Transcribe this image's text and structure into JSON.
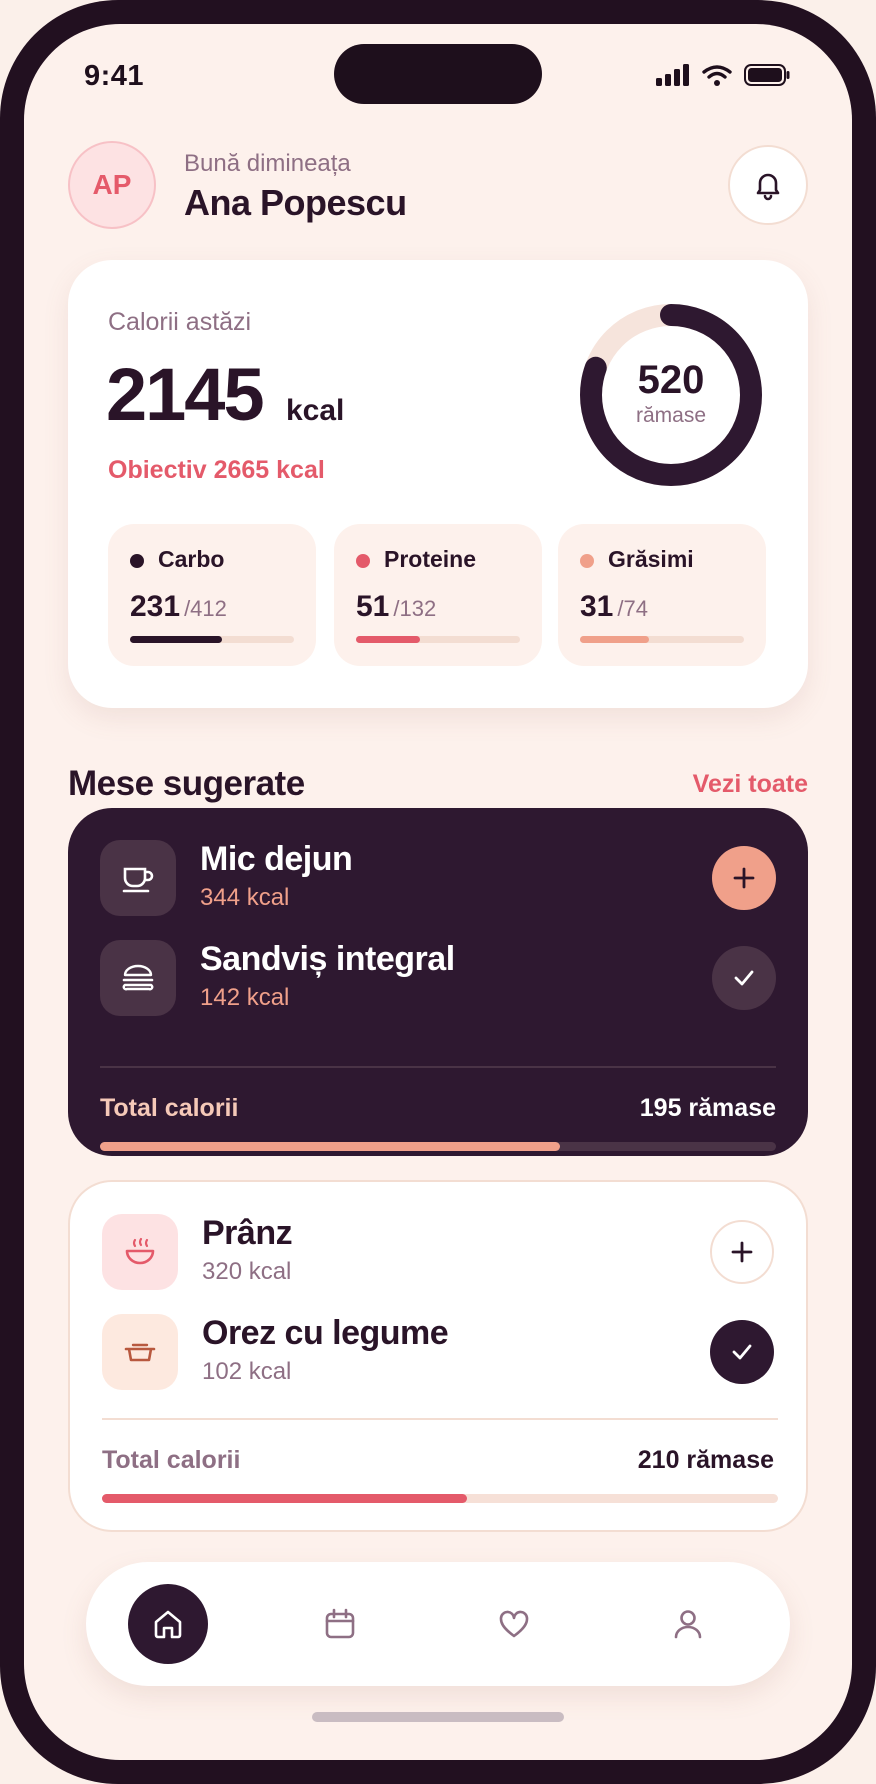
{
  "status_bar": {
    "time": "9:41"
  },
  "header": {
    "avatar_initials": "AP",
    "greeting": "Bună dimineața",
    "user_name": "Ana Popescu"
  },
  "calories": {
    "title": "Calorii astăzi",
    "value": "2145",
    "unit": "kcal",
    "goal": "Obiectiv 2665 kcal",
    "remaining_value": "520",
    "remaining_label": "rămase",
    "consumed_fraction": 0.805
  },
  "macros": [
    {
      "name": "Carbo",
      "value": "231",
      "target": "/412",
      "fraction": 0.56,
      "color": "#2a1428"
    },
    {
      "name": "Proteine",
      "value": "51",
      "target": "/132",
      "fraction": 0.39,
      "color": "#e45a6a"
    },
    {
      "name": "Grăsimi",
      "value": "31",
      "target": "/74",
      "fraction": 0.42,
      "color": "#f0a08a"
    }
  ],
  "section": {
    "title": "Mese sugerate",
    "link": "Vezi toate"
  },
  "meal_groups": [
    {
      "items": [
        {
          "name": "Mic dejun",
          "kcal": "344 kcal",
          "icon": "cup-icon",
          "action": "add"
        },
        {
          "name": "Sandviș integral",
          "kcal": "142 kcal",
          "icon": "burger-icon",
          "action": "check"
        }
      ],
      "total_label": "Total calorii",
      "total_value": "195 rămase",
      "progress": 0.68
    },
    {
      "items": [
        {
          "name": "Prânz",
          "kcal": "320 kcal",
          "icon": "bowl-icon",
          "action": "add"
        },
        {
          "name": "Orez cu legume",
          "kcal": "102 kcal",
          "icon": "dish-icon",
          "action": "check"
        }
      ],
      "total_label": "Total calorii",
      "total_value": "210 rămase",
      "progress": 0.54
    }
  ],
  "nav": [
    "home-icon",
    "calendar-icon",
    "heart-icon",
    "profile-icon"
  ],
  "colors": {
    "dark": "#2e1830",
    "accent": "#e45a6a",
    "peach": "#f0a08a",
    "background": "#fdf1ec"
  }
}
